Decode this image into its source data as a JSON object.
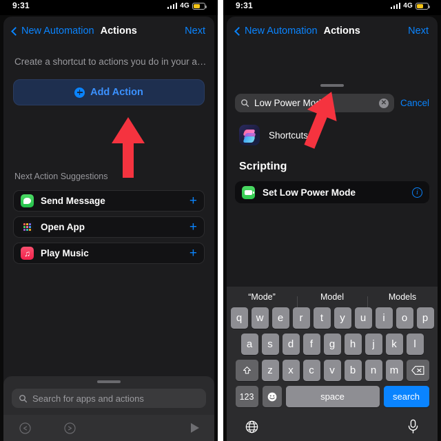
{
  "status_bar": {
    "time": "9:31",
    "network": "4G",
    "signal_icon": "cellular-bars-icon",
    "battery_icon": "battery-low-power-icon",
    "battery_color": "#f5c518"
  },
  "left_panel": {
    "nav": {
      "back_label": "New Automation",
      "title": "Actions",
      "next_label": "Next",
      "back_icon": "chevron-left-icon"
    },
    "subtitle": "Create a shortcut to actions you do in your a…",
    "add_action": {
      "label": "Add Action",
      "icon": "plus-circle-icon"
    },
    "suggestions_header": "Next Action Suggestions",
    "suggestions": [
      {
        "label": "Send Message",
        "icon": "messages-app-icon",
        "add_icon": "plus-icon"
      },
      {
        "label": "Open App",
        "icon": "app-grid-icon",
        "add_icon": "plus-icon"
      },
      {
        "label": "Play Music",
        "icon": "music-app-icon",
        "add_icon": "plus-icon"
      }
    ],
    "bottom_search_placeholder": "Search for apps and actions",
    "bottom_search_icon": "search-icon",
    "toolbar": {
      "undo_icon": "undo-icon",
      "redo_icon": "redo-icon",
      "play_icon": "play-icon"
    },
    "grabber": "sheet-grabber"
  },
  "right_panel": {
    "nav": {
      "back_label": "New Automation",
      "title": "Actions",
      "next_label": "Next",
      "back_icon": "chevron-left-icon"
    },
    "search": {
      "value": "Low Power Mode",
      "search_icon": "search-icon",
      "clear_icon": "clear-circle-icon",
      "clear_glyph": "✕",
      "cancel_label": "Cancel"
    },
    "app_result": {
      "name": "Shortcuts",
      "icon": "shortcuts-app-icon"
    },
    "group_title": "Scripting",
    "results": [
      {
        "label": "Set Low Power Mode",
        "icon": "low-power-mode-icon",
        "info_icon": "info-circle-icon",
        "info_glyph": "i"
      }
    ],
    "keyboard": {
      "suggestions": [
        "“Mode”",
        "Model",
        "Models"
      ],
      "row1": [
        "q",
        "w",
        "e",
        "r",
        "t",
        "y",
        "u",
        "i",
        "o",
        "p"
      ],
      "row2": [
        "a",
        "s",
        "d",
        "f",
        "g",
        "h",
        "j",
        "k",
        "l"
      ],
      "row3": [
        "z",
        "x",
        "c",
        "v",
        "b",
        "n",
        "m"
      ],
      "shift_icon": "shift-arrow-icon",
      "backspace_icon": "backspace-icon",
      "numbers_label": "123",
      "emoji_icon": "emoji-smiley-icon",
      "emoji_glyph": "☺",
      "space_label": "space",
      "search_label": "search",
      "globe_icon": "globe-icon",
      "mic_icon": "microphone-icon"
    }
  },
  "annotations": {
    "left_arrow": "red-arrow-pointing-to-add-action",
    "right_arrow": "red-arrow-pointing-to-search-field",
    "arrow_color": "#f5333f"
  }
}
